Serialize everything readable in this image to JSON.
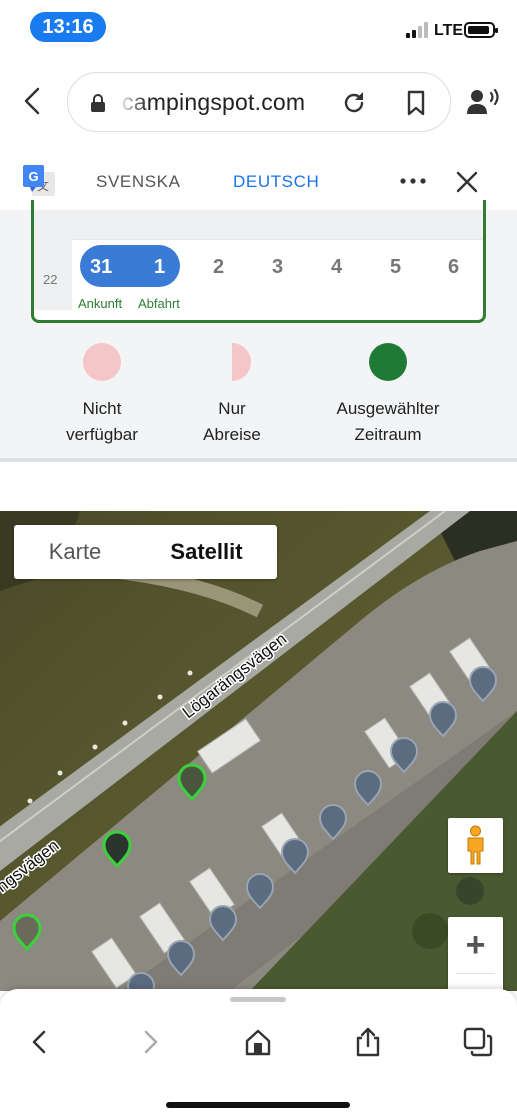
{
  "status_bar": {
    "time": "13:16",
    "network": "LTE",
    "battery_level": 0.9
  },
  "browser": {
    "url_text": "campingspot.com"
  },
  "translate_bar": {
    "tabs": [
      "SVENSKA",
      "DEUTSCH"
    ],
    "active_tab": "DEUTSCH"
  },
  "calendar": {
    "week_number": "22",
    "days": [
      "31",
      "1",
      "2",
      "3",
      "4",
      "5",
      "6"
    ],
    "selected_days": [
      "31",
      "1"
    ],
    "arrival_label": "Ankunft",
    "departure_label": "Abfahrt"
  },
  "legend": {
    "unavailable": [
      "Nicht",
      "verfügbar"
    ],
    "departure_only": [
      "Nur",
      "Abreise"
    ],
    "selected": [
      "Ausgewählter",
      "Zeitraum"
    ]
  },
  "legend_colors": {
    "unavailable": "#f5c6c8",
    "selected": "#1f7a35"
  },
  "map": {
    "toggle": {
      "map": "Karte",
      "satellite": "Satellit",
      "active": "Satellit"
    },
    "road_label_1": "Lögarängsvägen",
    "road_label_2": "ngsvägen",
    "zoom_in": "+",
    "marker_colors": {
      "available": "#3bd13b",
      "occupied": "#5b6b80"
    }
  },
  "icons": [
    "back-icon",
    "lock-icon",
    "reload-icon",
    "bookmark-icon",
    "reader-mode-icon",
    "google-translate-icon",
    "more-icon",
    "close-icon",
    "pegman-icon",
    "nav-back-icon",
    "nav-forward-icon",
    "home-icon",
    "share-icon",
    "tabs-icon"
  ]
}
